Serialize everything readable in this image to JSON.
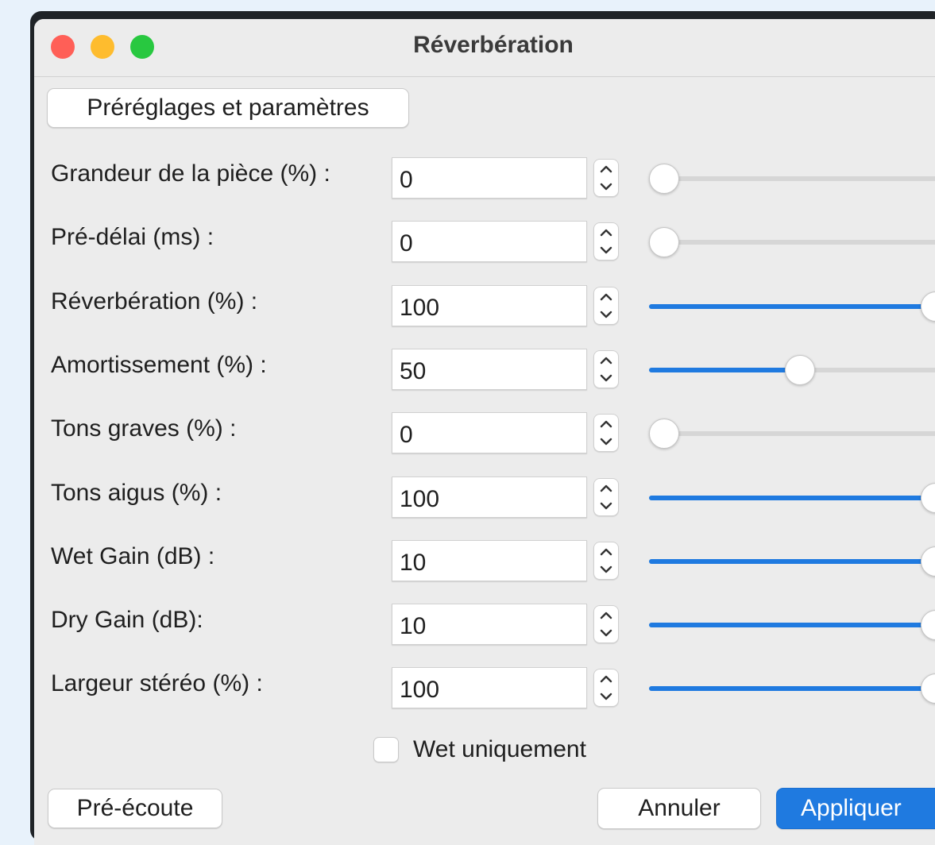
{
  "window": {
    "title": "Réverbération",
    "controls": [
      "close",
      "minimize",
      "zoom"
    ]
  },
  "presets_button": "Préréglages et paramètres",
  "parameters": [
    {
      "label": "Grandeur de la pièce (%) :",
      "value": "0",
      "fraction": 0.0
    },
    {
      "label": "Pré-délai (ms) :",
      "value": "0",
      "fraction": 0.0
    },
    {
      "label": "Réverbération (%) :",
      "value": "100",
      "fraction": 1.0
    },
    {
      "label": "Amortissement (%) :",
      "value": "50",
      "fraction": 0.5
    },
    {
      "label": "Tons graves (%) :",
      "value": "0",
      "fraction": 0.0
    },
    {
      "label": "Tons aigus (%) :",
      "value": "100",
      "fraction": 1.0
    },
    {
      "label": "Wet Gain (dB) :",
      "value": "10",
      "fraction": 1.0
    },
    {
      "label": "Dry Gain (dB):",
      "value": "10",
      "fraction": 1.0
    },
    {
      "label": "Largeur stéréo (%) :",
      "value": "100",
      "fraction": 1.0
    }
  ],
  "wet_only": {
    "label": "Wet uniquement",
    "checked": false
  },
  "buttons": {
    "preview": "Pré-écoute",
    "cancel": "Annuler",
    "apply": "Appliquer"
  },
  "colors": {
    "accent": "#1f7ae0",
    "close": "#ff5f57",
    "minimize": "#febc2e",
    "zoom": "#28c840",
    "background": "#e8f2fb"
  }
}
